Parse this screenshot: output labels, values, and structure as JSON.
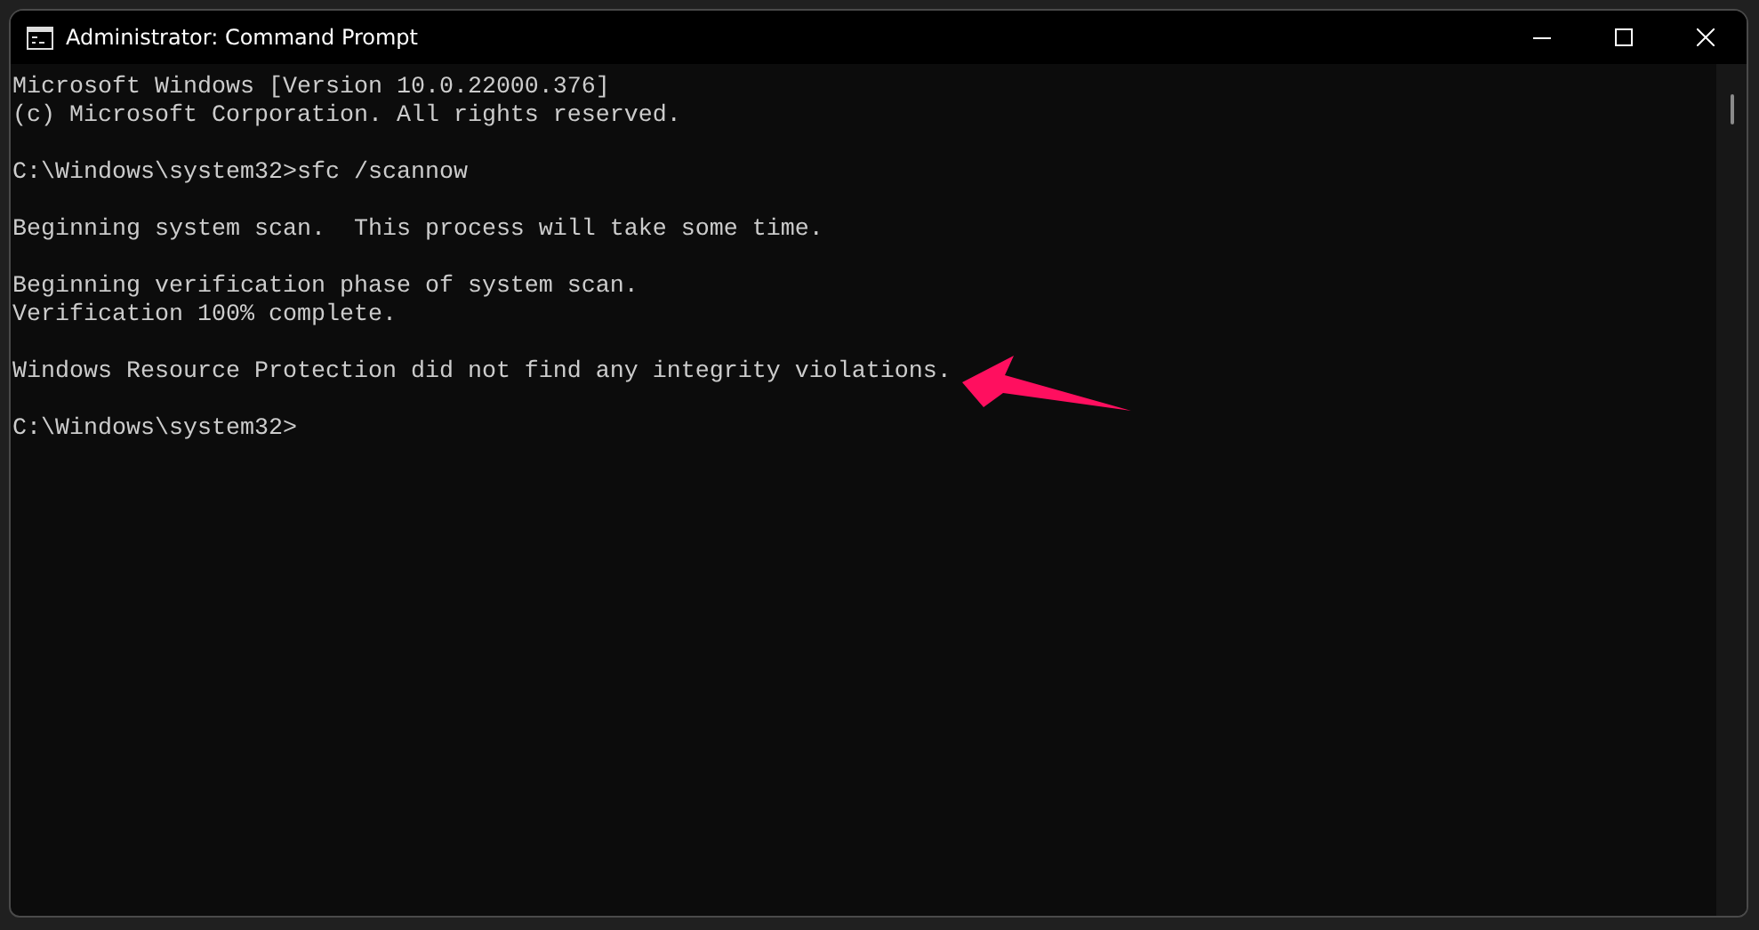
{
  "window": {
    "title": "Administrator: Command Prompt"
  },
  "console": {
    "blocks": [
      [
        "Microsoft Windows [Version 10.0.22000.376]",
        "(c) Microsoft Corporation. All rights reserved."
      ],
      [
        "C:\\Windows\\system32>sfc /scannow"
      ],
      [
        "Beginning system scan.  This process will take some time."
      ],
      [
        "Beginning verification phase of system scan.",
        "Verification 100% complete."
      ],
      [
        "Windows Resource Protection did not find any integrity violations."
      ],
      [
        "C:\\Windows\\system32>"
      ]
    ]
  }
}
